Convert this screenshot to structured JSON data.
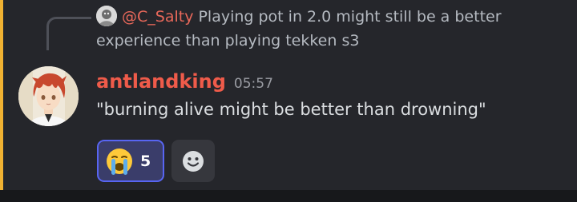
{
  "reply": {
    "author": "@C_Salty",
    "text": "Playing pot in 2.0 might still be a better experience than playing tekken s3"
  },
  "message": {
    "author": "antlandking",
    "timestamp": "05:57",
    "content": "\"burning alive might be better than drowning\""
  },
  "reactions": [
    {
      "emoji": "loudly-crying-face",
      "count": "5",
      "selected": true
    }
  ],
  "colors": {
    "mention_bar": "#f0b232",
    "author": "#ef5b4a",
    "reply_author": "#e8685a",
    "reaction_border": "#5865f2",
    "background": "#25262b"
  }
}
